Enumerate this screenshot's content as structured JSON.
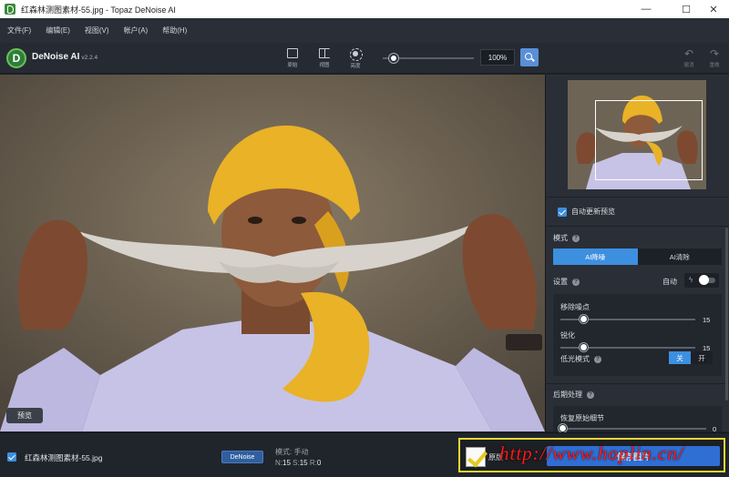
{
  "window": {
    "title": "红森林测图素材-55.jpg - Topaz DeNoise AI",
    "controls": {
      "minimize": "—",
      "maximize": "☐",
      "close": "✕"
    }
  },
  "menu": [
    "文件(F)",
    "编辑(E)",
    "视图(V)",
    "帐户(A)",
    "帮助(H)"
  ],
  "toolbar": {
    "app_name": "DeNoise AI",
    "version": "v2.2.4",
    "views": [
      {
        "label": "原始",
        "icon": "image-icon"
      },
      {
        "label": "视图",
        "icon": "split-view-icon"
      },
      {
        "label": "亮度",
        "icon": "brightness-icon"
      }
    ],
    "zoom_value": "100%",
    "zoom_slider_fraction": 0.1,
    "undo_label": "撤消",
    "redo_label": "重做"
  },
  "canvas": {
    "preview_label": "预览"
  },
  "panel": {
    "auto_update_label": "自动更新预览",
    "mode_label": "模式",
    "mode_options": [
      "AI降噪",
      "AI清除"
    ],
    "mode_selected": "AI降噪",
    "settings_label": "设置",
    "settings_auto_label": "自动",
    "settings_auto_on": false,
    "sliders": [
      {
        "label": "移除噪点",
        "value": "15",
        "fraction": 0.15
      },
      {
        "label": "锐化",
        "value": "15",
        "fraction": 0.15
      }
    ],
    "low_light_label": "低光模式",
    "low_light_options": [
      "关",
      "开"
    ],
    "low_light_selected": "关",
    "post_label": "后期处理",
    "restore_detail_label": "恢复原始细节",
    "restore_detail_value": "0",
    "restore_detail_fraction": 0
  },
  "filebar": {
    "file_name": "红森林测图素材-55.jpg",
    "model_badge": "DeNoise",
    "mode_text": "模式: 手动",
    "n_label": "N:",
    "n_value": "15",
    "s_label": "S:",
    "s_value": "15",
    "r_label": "R:",
    "r_value": "0",
    "compare_label": "原版",
    "save_label": "保存图片",
    "watermark": "http://www.hoplin.cn/"
  },
  "colors": {
    "accent": "#3d8fe0",
    "highlight_frame": "#e8d633",
    "watermark": "#ff1a1a"
  }
}
